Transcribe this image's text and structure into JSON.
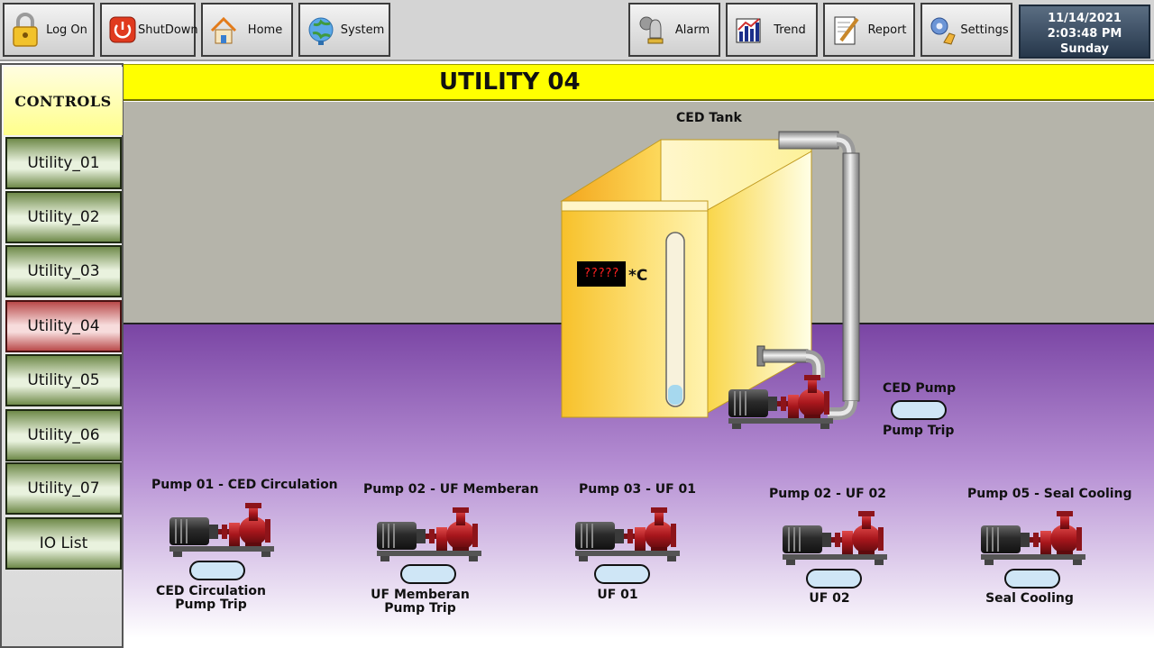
{
  "toolbar": {
    "buttons": [
      {
        "label": "Log On",
        "icon": "lock-icon"
      },
      {
        "label": "ShutDown",
        "icon": "power-icon"
      },
      {
        "label": "Home",
        "icon": "home-icon"
      },
      {
        "label": "System",
        "icon": "system-globe-icon"
      },
      {
        "label": "Alarm",
        "icon": "alarm-bell-icon"
      },
      {
        "label": "Trend",
        "icon": "trend-chart-icon"
      },
      {
        "label": "Report",
        "icon": "report-pen-icon"
      },
      {
        "label": "Settings",
        "icon": "settings-icon"
      }
    ],
    "clock": {
      "date": "11/14/2021",
      "time": "2:03:48 PM",
      "day": "Sunday"
    }
  },
  "sidebar": {
    "heading": "CONTROLS",
    "items": [
      {
        "label": "Utility_01",
        "active": false
      },
      {
        "label": "Utility_02",
        "active": false
      },
      {
        "label": "Utility_03",
        "active": false
      },
      {
        "label": "Utility_04",
        "active": true
      },
      {
        "label": "Utility_05",
        "active": false
      },
      {
        "label": "Utility_06",
        "active": false
      },
      {
        "label": "Utility_07",
        "active": false
      },
      {
        "label": "IO List",
        "active": false
      }
    ]
  },
  "screen": {
    "title": "UTILITY 04"
  },
  "tank": {
    "label": "CED Tank",
    "temperature": "?????",
    "unit": "*C"
  },
  "ced_pump": {
    "name": "CED Pump",
    "status": "Pump Trip"
  },
  "pumps": [
    {
      "name": "Pump 01  - CED Circulation",
      "status": "CED Circulation\nPump Trip"
    },
    {
      "name": "Pump 02 - UF Memberan",
      "status": "UF Memberan\nPump Trip"
    },
    {
      "name": "Pump 03 - UF 01",
      "status": "UF 01"
    },
    {
      "name": "Pump 02 - UF 02",
      "status": "UF 02"
    },
    {
      "name": "Pump 05 - Seal Cooling",
      "status": "Seal Cooling"
    }
  ],
  "colors": {
    "title_bar": "#ffff00",
    "nav_button": "#6f8a4a",
    "nav_button_active": "#b94a4a",
    "wall": "#b5b4aa",
    "floor": "#7a45a4",
    "pump_body": "#b01c22",
    "motor": "#333333",
    "indicator": "#cfe6f6",
    "tank": "#f8c83a"
  }
}
